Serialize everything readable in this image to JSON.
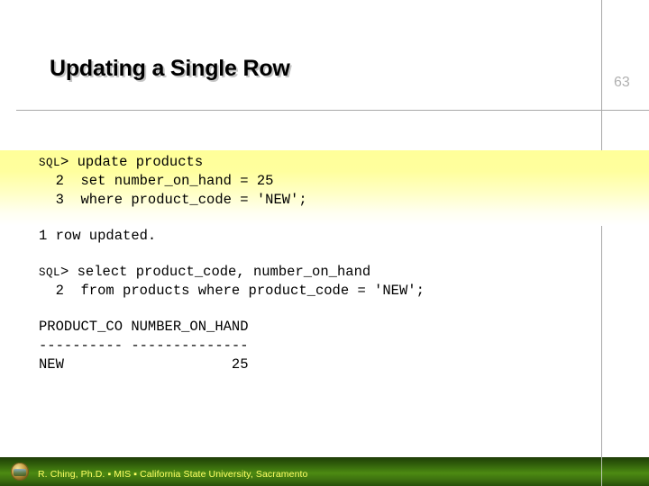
{
  "slide": {
    "title": "Updating a Single Row",
    "number": "63"
  },
  "code": {
    "lines": [
      {
        "prompt": "SQL",
        "text": "> update products"
      },
      {
        "prompt": "",
        "text": "  2  set number_on_hand = 25"
      },
      {
        "prompt": "",
        "text": "  3  where product_code = 'NEW';"
      },
      {
        "prompt": "",
        "text": ""
      },
      {
        "prompt": "",
        "text": "1 row updated."
      },
      {
        "prompt": "",
        "text": ""
      },
      {
        "prompt": "SQL",
        "text": "> select product_code, number_on_hand"
      },
      {
        "prompt": "",
        "text": "  2  from products where product_code = 'NEW';"
      },
      {
        "prompt": "",
        "text": ""
      },
      {
        "prompt": "",
        "text": "PRODUCT_CO NUMBER_ON_HAND"
      },
      {
        "prompt": "",
        "text": "---------- --------------"
      },
      {
        "prompt": "",
        "text": "NEW                    25"
      }
    ]
  },
  "footer": {
    "text": "R. Ching, Ph.D. ▪ MIS  ▪ California State University, Sacramento",
    "logo_icon": "university-seal-icon"
  },
  "colors": {
    "highlight": "#ffff99",
    "footer_green": "#4c8a12",
    "footer_text": "#ffff66",
    "rule": "#a8a8a8",
    "slide_number": "#b0b0b0"
  }
}
